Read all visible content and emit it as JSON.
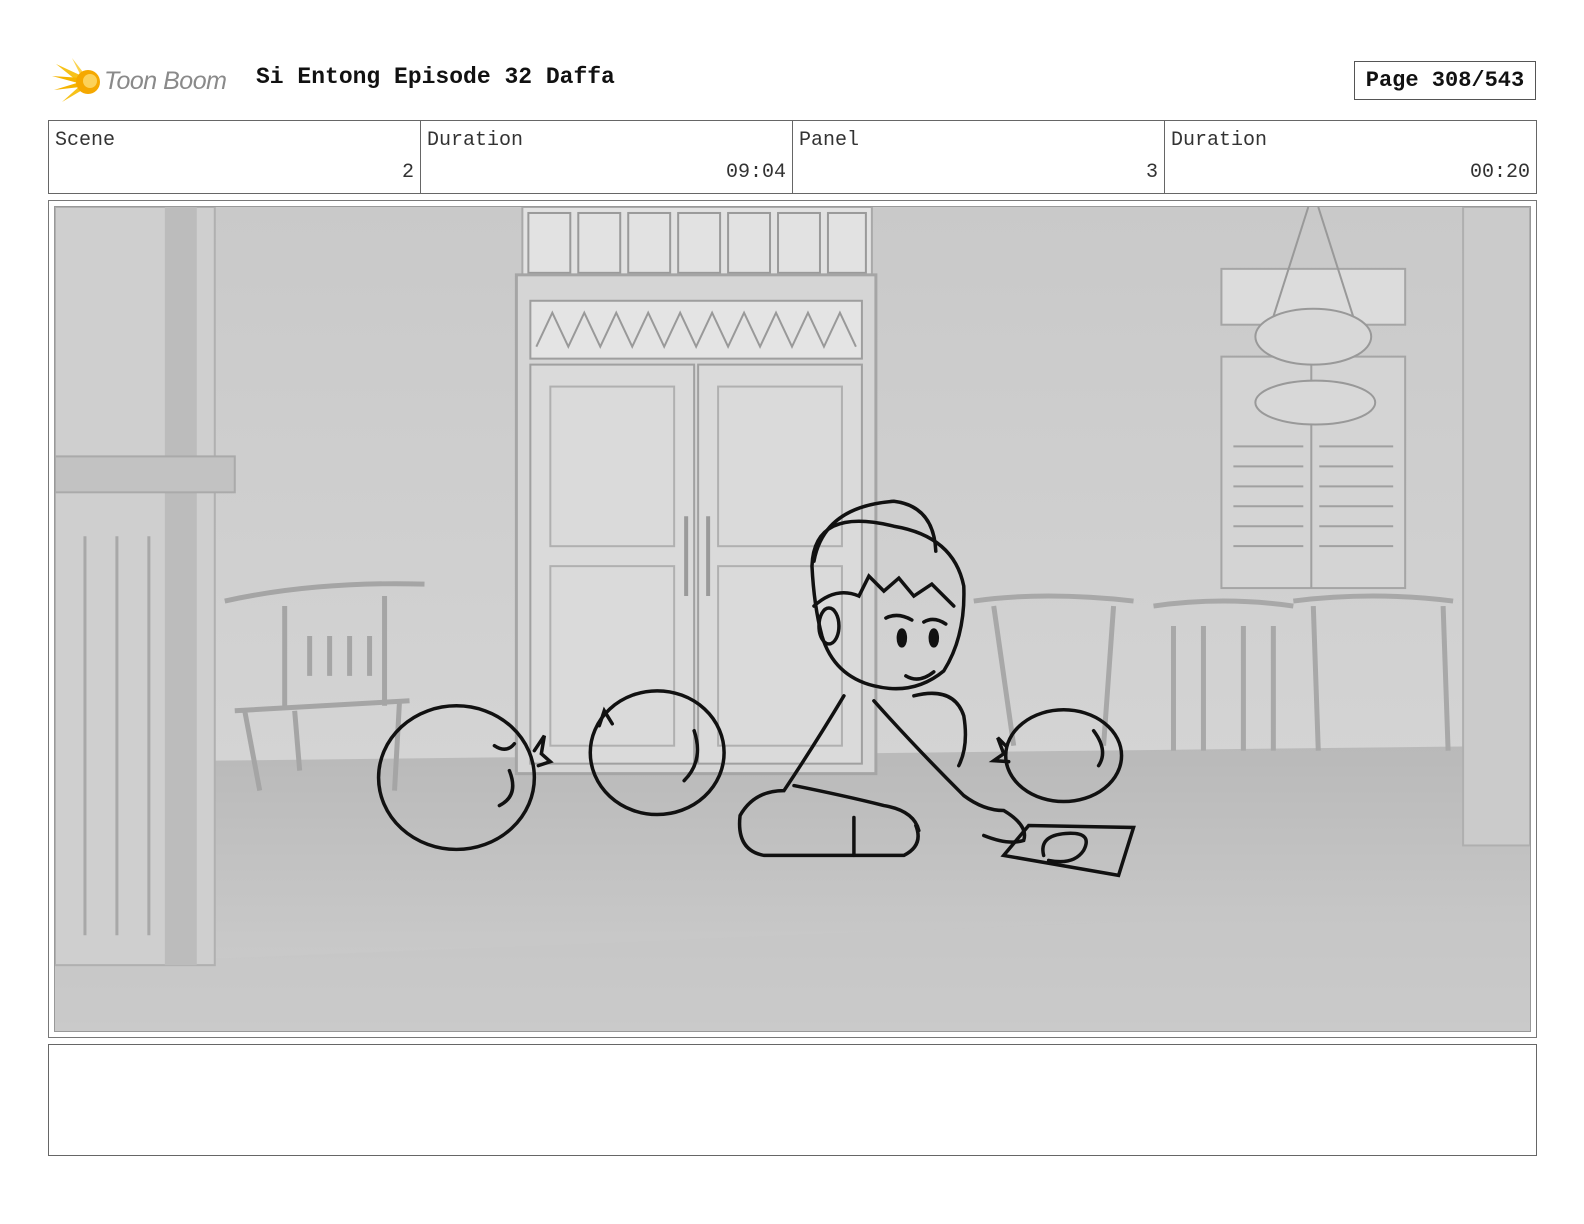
{
  "header": {
    "logo_text": "Toon Boom",
    "title": "Si Entong Episode 32 Daffa",
    "page": "Page 308/543"
  },
  "info": {
    "scene_label": "Scene",
    "scene_value": "2",
    "duration_label": "Duration",
    "duration_value": "09:04",
    "panel_label": "Panel",
    "panel_value": "3",
    "panel_duration_label": "Duration",
    "panel_duration_value": "00:20"
  },
  "icons": {
    "logo": "toon-boom-sunburst-logo"
  },
  "colors": {
    "logo_accent": "#f5b400",
    "logo_text": "#8a8a8a"
  },
  "notes": {
    "text": ""
  }
}
